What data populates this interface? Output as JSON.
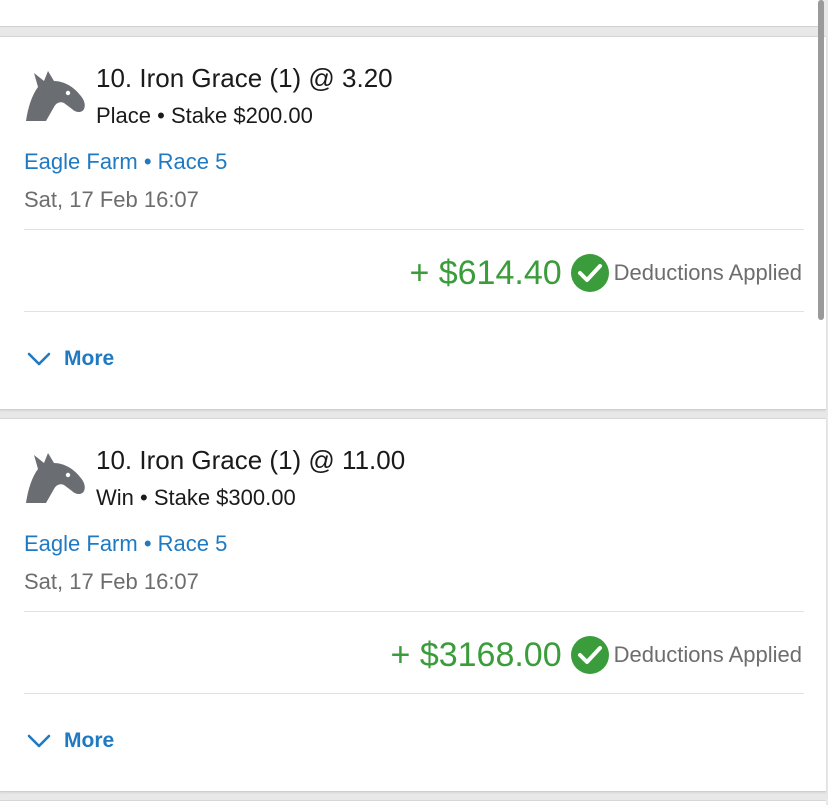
{
  "bets": [
    {
      "title": "10. Iron Grace (1) @ 3.20",
      "subtitle": "Place • Stake $200.00",
      "venue": "Eagle Farm • Race 5",
      "date": "Sat, 17 Feb 16:07",
      "payout": "+ $614.40",
      "status": "Deductions Applied",
      "more_label": "More",
      "icon": "horse-head-icon"
    },
    {
      "title": "10. Iron Grace (1) @ 11.00",
      "subtitle": "Win • Stake $300.00",
      "venue": "Eagle Farm • Race 5",
      "date": "Sat, 17 Feb 16:07",
      "payout": "+ $3168.00",
      "status": "Deductions Applied",
      "more_label": "More",
      "icon": "horse-head-icon"
    }
  ],
  "colors": {
    "accent_blue": "#1f7ac2",
    "payout_green": "#3a9c3a",
    "text_dark": "#1a1a1a",
    "text_gray": "#6d6d6d"
  }
}
